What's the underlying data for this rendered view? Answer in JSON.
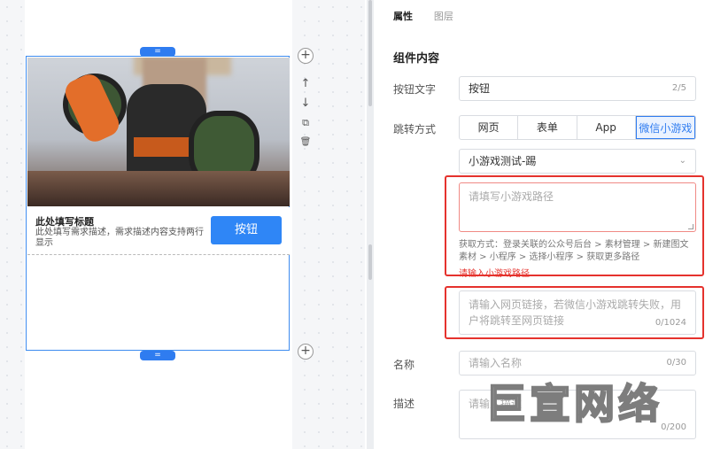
{
  "canvas": {
    "component": {
      "title": "此处填写标题",
      "description": "此处填写需求描述，需求描述内容支持两行显示",
      "button_label": "按钮"
    },
    "tools": {
      "add": "+",
      "move_up": "↑",
      "move_down": "↓",
      "copy": "⧉",
      "delete": "🗑"
    }
  },
  "panel": {
    "tabs": [
      {
        "label": "属性",
        "active": true
      },
      {
        "label": "图层",
        "active": false
      }
    ],
    "section_title": "组件内容",
    "button_text": {
      "label": "按钮文字",
      "value": "按钮",
      "count": "2/5"
    },
    "jump": {
      "label": "跳转方式",
      "options": [
        "网页",
        "表单",
        "App",
        "微信小游戏"
      ],
      "selected": "微信小游戏",
      "select_value": "小游戏测试-踢",
      "path_placeholder": "请填写小游戏路径",
      "path_hint": "获取方式：登录关联的公众号后台 > 素材管理 > 新建图文素材 > 小程序 > 选择小程序 > 获取更多路径",
      "path_error": "请输入小游戏路径",
      "fallback_placeholder": "请输入网页链接，若微信小游戏跳转失败，用户将跳转至网页链接",
      "fallback_count": "0/1024"
    },
    "name": {
      "label": "名称",
      "placeholder": "请输入名称",
      "count": "0/30"
    },
    "desc": {
      "label": "描述",
      "placeholder": "请输入描述",
      "count": "0/200"
    }
  },
  "watermark": "巨宣网络",
  "colors": {
    "accent": "#2f7cf0",
    "error": "#e5322d"
  }
}
